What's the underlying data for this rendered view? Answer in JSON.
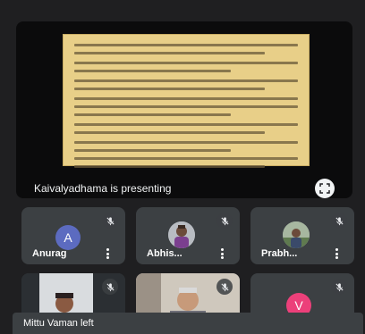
{
  "presentation": {
    "label": "Kaivalyadhama is presenting"
  },
  "participants": [
    {
      "name": "Anurag",
      "initial": "A",
      "kind": "letter"
    },
    {
      "name": "Abhis...",
      "kind": "photo"
    },
    {
      "name": "Prabh...",
      "kind": "photo"
    },
    {
      "name": "",
      "kind": "video"
    },
    {
      "name": "",
      "kind": "video"
    },
    {
      "name": "",
      "initial": "V",
      "kind": "letter"
    }
  ],
  "notification": {
    "text": "Mittu Vaman left"
  },
  "colors": {
    "background": "#202124",
    "tile": "#3c4043",
    "slide": "#e8cf88",
    "avatar_anurag": "#5c6bc0",
    "avatar_v": "#ec407a"
  },
  "icons": {
    "mic_off": "mic-off-icon",
    "fullscreen": "fullscreen-icon",
    "more": "more-vert-icon"
  }
}
